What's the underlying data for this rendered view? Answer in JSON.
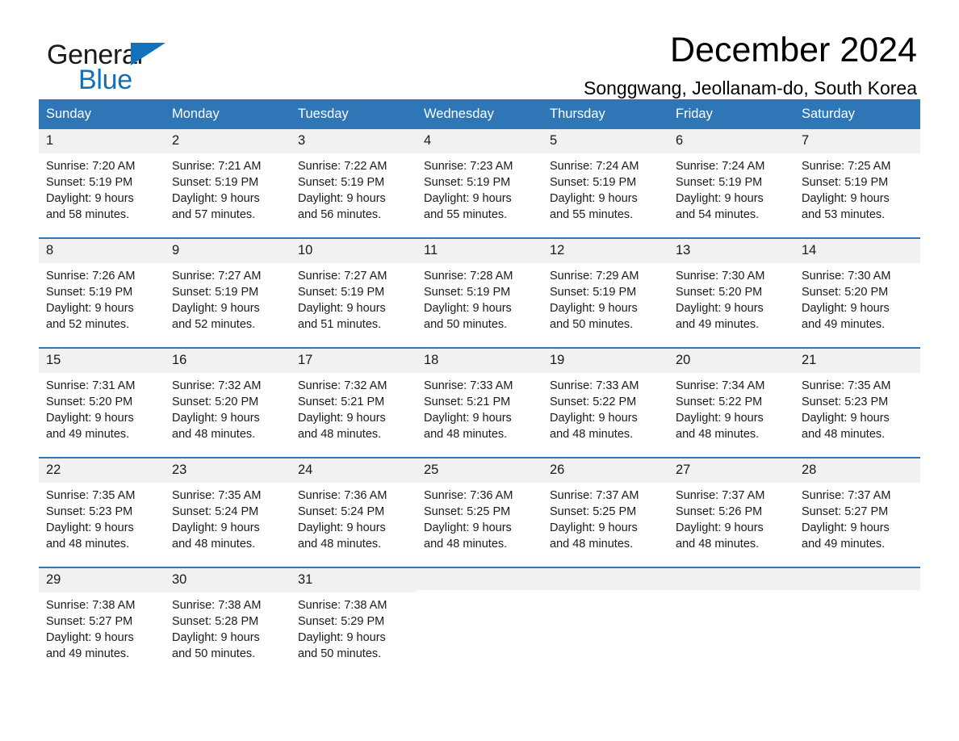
{
  "brand": {
    "name_part1": "General",
    "name_part2": "Blue",
    "accent_color": "#1470b8"
  },
  "header": {
    "title": "December 2024",
    "location": "Songgwang, Jeollanam-do, South Korea"
  },
  "theme": {
    "header_blue": "#2e76b6",
    "day_band_gray": "#f1f1f1"
  },
  "weekdays": [
    "Sunday",
    "Monday",
    "Tuesday",
    "Wednesday",
    "Thursday",
    "Friday",
    "Saturday"
  ],
  "weeks": [
    [
      {
        "day": "1",
        "sunrise": "Sunrise: 7:20 AM",
        "sunset": "Sunset: 5:19 PM",
        "daylight_line1": "Daylight: 9 hours",
        "daylight_line2": "and 58 minutes."
      },
      {
        "day": "2",
        "sunrise": "Sunrise: 7:21 AM",
        "sunset": "Sunset: 5:19 PM",
        "daylight_line1": "Daylight: 9 hours",
        "daylight_line2": "and 57 minutes."
      },
      {
        "day": "3",
        "sunrise": "Sunrise: 7:22 AM",
        "sunset": "Sunset: 5:19 PM",
        "daylight_line1": "Daylight: 9 hours",
        "daylight_line2": "and 56 minutes."
      },
      {
        "day": "4",
        "sunrise": "Sunrise: 7:23 AM",
        "sunset": "Sunset: 5:19 PM",
        "daylight_line1": "Daylight: 9 hours",
        "daylight_line2": "and 55 minutes."
      },
      {
        "day": "5",
        "sunrise": "Sunrise: 7:24 AM",
        "sunset": "Sunset: 5:19 PM",
        "daylight_line1": "Daylight: 9 hours",
        "daylight_line2": "and 55 minutes."
      },
      {
        "day": "6",
        "sunrise": "Sunrise: 7:24 AM",
        "sunset": "Sunset: 5:19 PM",
        "daylight_line1": "Daylight: 9 hours",
        "daylight_line2": "and 54 minutes."
      },
      {
        "day": "7",
        "sunrise": "Sunrise: 7:25 AM",
        "sunset": "Sunset: 5:19 PM",
        "daylight_line1": "Daylight: 9 hours",
        "daylight_line2": "and 53 minutes."
      }
    ],
    [
      {
        "day": "8",
        "sunrise": "Sunrise: 7:26 AM",
        "sunset": "Sunset: 5:19 PM",
        "daylight_line1": "Daylight: 9 hours",
        "daylight_line2": "and 52 minutes."
      },
      {
        "day": "9",
        "sunrise": "Sunrise: 7:27 AM",
        "sunset": "Sunset: 5:19 PM",
        "daylight_line1": "Daylight: 9 hours",
        "daylight_line2": "and 52 minutes."
      },
      {
        "day": "10",
        "sunrise": "Sunrise: 7:27 AM",
        "sunset": "Sunset: 5:19 PM",
        "daylight_line1": "Daylight: 9 hours",
        "daylight_line2": "and 51 minutes."
      },
      {
        "day": "11",
        "sunrise": "Sunrise: 7:28 AM",
        "sunset": "Sunset: 5:19 PM",
        "daylight_line1": "Daylight: 9 hours",
        "daylight_line2": "and 50 minutes."
      },
      {
        "day": "12",
        "sunrise": "Sunrise: 7:29 AM",
        "sunset": "Sunset: 5:19 PM",
        "daylight_line1": "Daylight: 9 hours",
        "daylight_line2": "and 50 minutes."
      },
      {
        "day": "13",
        "sunrise": "Sunrise: 7:30 AM",
        "sunset": "Sunset: 5:20 PM",
        "daylight_line1": "Daylight: 9 hours",
        "daylight_line2": "and 49 minutes."
      },
      {
        "day": "14",
        "sunrise": "Sunrise: 7:30 AM",
        "sunset": "Sunset: 5:20 PM",
        "daylight_line1": "Daylight: 9 hours",
        "daylight_line2": "and 49 minutes."
      }
    ],
    [
      {
        "day": "15",
        "sunrise": "Sunrise: 7:31 AM",
        "sunset": "Sunset: 5:20 PM",
        "daylight_line1": "Daylight: 9 hours",
        "daylight_line2": "and 49 minutes."
      },
      {
        "day": "16",
        "sunrise": "Sunrise: 7:32 AM",
        "sunset": "Sunset: 5:20 PM",
        "daylight_line1": "Daylight: 9 hours",
        "daylight_line2": "and 48 minutes."
      },
      {
        "day": "17",
        "sunrise": "Sunrise: 7:32 AM",
        "sunset": "Sunset: 5:21 PM",
        "daylight_line1": "Daylight: 9 hours",
        "daylight_line2": "and 48 minutes."
      },
      {
        "day": "18",
        "sunrise": "Sunrise: 7:33 AM",
        "sunset": "Sunset: 5:21 PM",
        "daylight_line1": "Daylight: 9 hours",
        "daylight_line2": "and 48 minutes."
      },
      {
        "day": "19",
        "sunrise": "Sunrise: 7:33 AM",
        "sunset": "Sunset: 5:22 PM",
        "daylight_line1": "Daylight: 9 hours",
        "daylight_line2": "and 48 minutes."
      },
      {
        "day": "20",
        "sunrise": "Sunrise: 7:34 AM",
        "sunset": "Sunset: 5:22 PM",
        "daylight_line1": "Daylight: 9 hours",
        "daylight_line2": "and 48 minutes."
      },
      {
        "day": "21",
        "sunrise": "Sunrise: 7:35 AM",
        "sunset": "Sunset: 5:23 PM",
        "daylight_line1": "Daylight: 9 hours",
        "daylight_line2": "and 48 minutes."
      }
    ],
    [
      {
        "day": "22",
        "sunrise": "Sunrise: 7:35 AM",
        "sunset": "Sunset: 5:23 PM",
        "daylight_line1": "Daylight: 9 hours",
        "daylight_line2": "and 48 minutes."
      },
      {
        "day": "23",
        "sunrise": "Sunrise: 7:35 AM",
        "sunset": "Sunset: 5:24 PM",
        "daylight_line1": "Daylight: 9 hours",
        "daylight_line2": "and 48 minutes."
      },
      {
        "day": "24",
        "sunrise": "Sunrise: 7:36 AM",
        "sunset": "Sunset: 5:24 PM",
        "daylight_line1": "Daylight: 9 hours",
        "daylight_line2": "and 48 minutes."
      },
      {
        "day": "25",
        "sunrise": "Sunrise: 7:36 AM",
        "sunset": "Sunset: 5:25 PM",
        "daylight_line1": "Daylight: 9 hours",
        "daylight_line2": "and 48 minutes."
      },
      {
        "day": "26",
        "sunrise": "Sunrise: 7:37 AM",
        "sunset": "Sunset: 5:25 PM",
        "daylight_line1": "Daylight: 9 hours",
        "daylight_line2": "and 48 minutes."
      },
      {
        "day": "27",
        "sunrise": "Sunrise: 7:37 AM",
        "sunset": "Sunset: 5:26 PM",
        "daylight_line1": "Daylight: 9 hours",
        "daylight_line2": "and 48 minutes."
      },
      {
        "day": "28",
        "sunrise": "Sunrise: 7:37 AM",
        "sunset": "Sunset: 5:27 PM",
        "daylight_line1": "Daylight: 9 hours",
        "daylight_line2": "and 49 minutes."
      }
    ],
    [
      {
        "day": "29",
        "sunrise": "Sunrise: 7:38 AM",
        "sunset": "Sunset: 5:27 PM",
        "daylight_line1": "Daylight: 9 hours",
        "daylight_line2": "and 49 minutes."
      },
      {
        "day": "30",
        "sunrise": "Sunrise: 7:38 AM",
        "sunset": "Sunset: 5:28 PM",
        "daylight_line1": "Daylight: 9 hours",
        "daylight_line2": "and 50 minutes."
      },
      {
        "day": "31",
        "sunrise": "Sunrise: 7:38 AM",
        "sunset": "Sunset: 5:29 PM",
        "daylight_line1": "Daylight: 9 hours",
        "daylight_line2": "and 50 minutes."
      },
      {
        "day": "",
        "sunrise": "",
        "sunset": "",
        "daylight_line1": "",
        "daylight_line2": ""
      },
      {
        "day": "",
        "sunrise": "",
        "sunset": "",
        "daylight_line1": "",
        "daylight_line2": ""
      },
      {
        "day": "",
        "sunrise": "",
        "sunset": "",
        "daylight_line1": "",
        "daylight_line2": ""
      },
      {
        "day": "",
        "sunrise": "",
        "sunset": "",
        "daylight_line1": "",
        "daylight_line2": ""
      }
    ]
  ]
}
